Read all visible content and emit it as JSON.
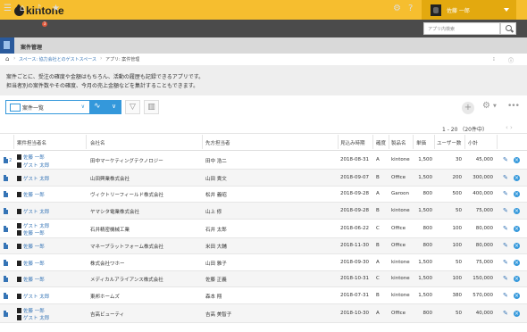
{
  "header": {
    "logo_text": "kintone",
    "user_name": "佐藤 一郎",
    "notification_count": "3",
    "search_placeholder": "アプリ内検索"
  },
  "app": {
    "title": "案件管理",
    "breadcrumb": {
      "space": "スペース: 協力会社とのゲストスペース",
      "app": "アプリ: 案件管理"
    },
    "description": [
      "案件ごとに、受注の確度や金額はもちろん、活動の履歴も記録できるアプリです。",
      "担当者別の案件数やその確度、今月の売上金額などを集計することもできます。"
    ]
  },
  "toolbar": {
    "view_name": "案件一覧",
    "pager_text": "1 - 20 （20件中）"
  },
  "table": {
    "columns": [
      "案件担当者名",
      "会社名",
      "先方担当者",
      "見込み時期",
      "確度",
      "製品名",
      "単価",
      "ユーザー数",
      "小計"
    ],
    "rows": [
      {
        "badge": "2",
        "persons": [
          "佐藤 一郎",
          "ゲスト 太郎"
        ],
        "company": "田中マーケティングテクノロジー",
        "contact": "田中 浩二",
        "date": "2018-08-31",
        "rank": "A",
        "product": "kintone",
        "price": "1,500",
        "users": "30",
        "subtotal": "45,000"
      },
      {
        "persons": [
          "ゲスト 太郎"
        ],
        "company": "山田興業株式会社",
        "contact": "山田 貴文",
        "date": "2018-09-07",
        "rank": "B",
        "product": "Office",
        "price": "1,500",
        "users": "200",
        "subtotal": "300,000"
      },
      {
        "persons": [
          "佐藤 一郎"
        ],
        "company": "ヴィクトリーフィールド株式会社",
        "contact": "松井 義昭",
        "date": "2018-09-28",
        "rank": "A",
        "product": "Garoon",
        "price": "800",
        "users": "500",
        "subtotal": "400,000"
      },
      {
        "persons": [
          "ゲスト 太郎"
        ],
        "company": "ヤマシタ電業株式会社",
        "contact": "山上 修",
        "date": "2018-09-28",
        "rank": "B",
        "product": "kintone",
        "price": "1,500",
        "users": "50",
        "subtotal": "75,000"
      },
      {
        "persons": [
          "ゲスト 太郎",
          "佐藤 一郎"
        ],
        "company": "石井精密機械工業",
        "contact": "石井 太郎",
        "date": "2018-06-22",
        "rank": "C",
        "product": "Office",
        "price": "800",
        "users": "100",
        "subtotal": "80,000"
      },
      {
        "persons": [
          "佐藤 一郎"
        ],
        "company": "マネープラットフォーム株式会社",
        "contact": "米田 大輔",
        "date": "2018-11-30",
        "rank": "B",
        "product": "Office",
        "price": "800",
        "users": "100",
        "subtotal": "80,000"
      },
      {
        "persons": [
          "佐藤 一郎"
        ],
        "company": "株式会社ワホー",
        "contact": "山田 雅子",
        "date": "2018-09-30",
        "rank": "A",
        "product": "kintone",
        "price": "1,500",
        "users": "50",
        "subtotal": "75,000"
      },
      {
        "persons": [
          "佐藤 一郎"
        ],
        "company": "メディカルアライアンス株式会社",
        "contact": "佐藤 正義",
        "date": "2018-10-31",
        "rank": "C",
        "product": "kintone",
        "price": "1,500",
        "users": "100",
        "subtotal": "150,000"
      },
      {
        "persons": [
          "ゲスト 太郎"
        ],
        "company": "東邦ホームズ",
        "contact": "森本 翔",
        "date": "2018-07-31",
        "rank": "B",
        "product": "kintone",
        "price": "1,500",
        "users": "380",
        "subtotal": "570,000"
      },
      {
        "persons": [
          "佐藤 一郎",
          "ゲスト 太郎"
        ],
        "company": "吉高ビューティ",
        "contact": "吉高 美智子",
        "date": "2018-10-30",
        "rank": "A",
        "product": "Office",
        "price": "800",
        "users": "50",
        "subtotal": "40,000"
      }
    ]
  }
}
